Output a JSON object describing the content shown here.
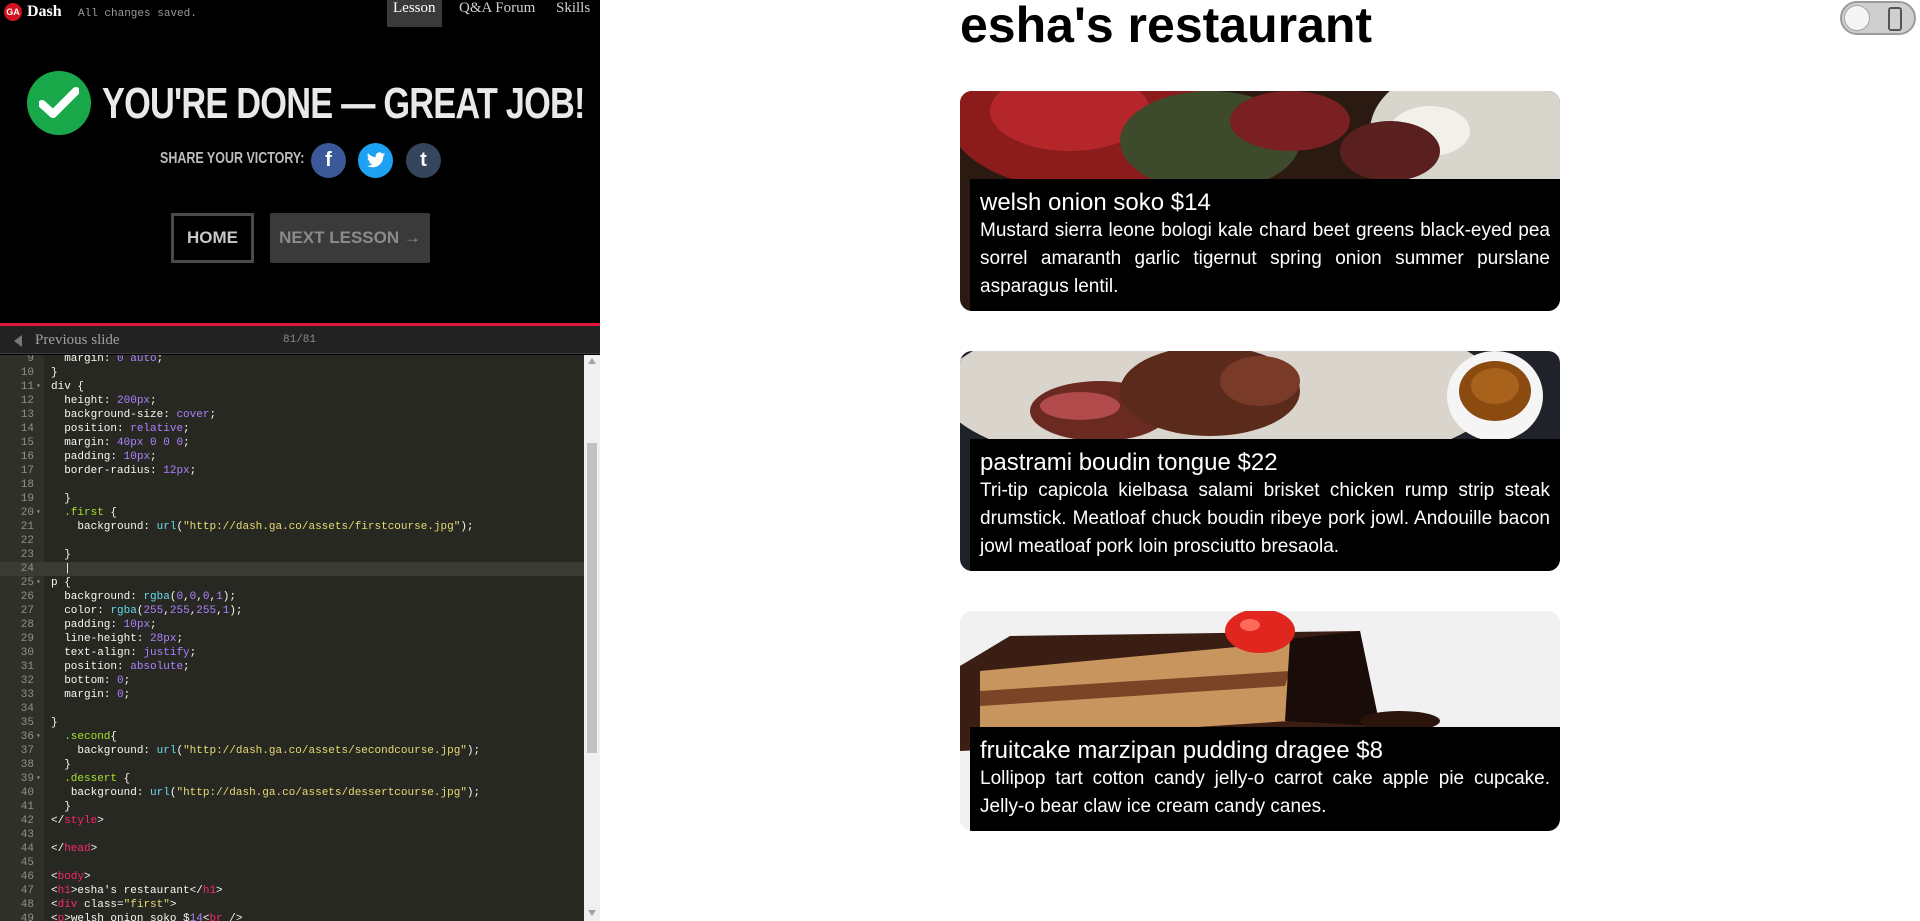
{
  "topbar": {
    "logo": "GA",
    "app_name": "Dash",
    "save_status": "All changes saved.",
    "nav": [
      {
        "label": "Lesson"
      },
      {
        "label": "Q&A Forum"
      },
      {
        "label": "Skills"
      }
    ]
  },
  "done_panel": {
    "title": "YOU'RE DONE — GREAT JOB!",
    "share_label": "SHARE YOUR VICTORY:",
    "social": {
      "facebook": "f",
      "twitter": "t",
      "tumblr": "t"
    },
    "home_label": "HOME",
    "next_label": "NEXT LESSON →"
  },
  "slidebar": {
    "prev_label": "Previous slide",
    "count": "81/81"
  },
  "editor": {
    "active_line": 24,
    "lines": [
      {
        "n": "9",
        "code": "  margin: 0 auto;"
      },
      {
        "n": "10",
        "code": "}"
      },
      {
        "n": "11",
        "code": "div {"
      },
      {
        "n": "12",
        "code": "  height: 200px;"
      },
      {
        "n": "13",
        "code": "  background-size: cover;"
      },
      {
        "n": "14",
        "code": "  position: relative;"
      },
      {
        "n": "15",
        "code": "  margin: 40px 0 0 0;"
      },
      {
        "n": "16",
        "code": "  padding: 10px;"
      },
      {
        "n": "17",
        "code": "  border-radius: 12px;"
      },
      {
        "n": "18",
        "code": ""
      },
      {
        "n": "19",
        "code": "  }"
      },
      {
        "n": "20",
        "code": "  .first {"
      },
      {
        "n": "21",
        "code": "    background: url(\"http://dash.ga.co/assets/firstcourse.jpg\");"
      },
      {
        "n": "22",
        "code": ""
      },
      {
        "n": "23",
        "code": "  }"
      },
      {
        "n": "24",
        "code": "  |"
      },
      {
        "n": "25",
        "code": "p {"
      },
      {
        "n": "26",
        "code": "  background: rgba(0,0,0,1);"
      },
      {
        "n": "27",
        "code": "  color: rgba(255,255,255,1);"
      },
      {
        "n": "28",
        "code": "  padding: 10px;"
      },
      {
        "n": "29",
        "code": "  line-height: 28px;"
      },
      {
        "n": "30",
        "code": "  text-align: justify;"
      },
      {
        "n": "31",
        "code": "  position: absolute;"
      },
      {
        "n": "32",
        "code": "  bottom: 0;"
      },
      {
        "n": "33",
        "code": "  margin: 0;"
      },
      {
        "n": "34",
        "code": ""
      },
      {
        "n": "35",
        "code": "}"
      },
      {
        "n": "36",
        "code": "  .second{"
      },
      {
        "n": "37",
        "code": "    background: url(\"http://dash.ga.co/assets/secondcourse.jpg\");"
      },
      {
        "n": "38",
        "code": "  }"
      },
      {
        "n": "39",
        "code": "  .dessert {"
      },
      {
        "n": "40",
        "code": "   background: url(\"http://dash.ga.co/assets/dessertcourse.jpg\");"
      },
      {
        "n": "41",
        "code": "  }"
      },
      {
        "n": "42",
        "code": "</style>"
      },
      {
        "n": "43",
        "code": ""
      },
      {
        "n": "44",
        "code": "</head>"
      },
      {
        "n": "45",
        "code": ""
      },
      {
        "n": "46",
        "code": "<body>"
      },
      {
        "n": "47",
        "code": "<h1>esha's restaurant</h1>"
      },
      {
        "n": "48",
        "code": "<div class=\"first\">"
      },
      {
        "n": "49",
        "code": "<p>welsh onion soko $14<br />"
      }
    ]
  },
  "preview": {
    "title": "esha's restaurant",
    "courses": [
      {
        "name": "welsh onion soko $14",
        "description": "Mustard sierra leone bologi kale chard beet greens black-eyed pea sorrel amaranth garlic tigernut spring onion summer purslane asparagus lentil."
      },
      {
        "name": "pastrami boudin tongue $22",
        "description": "Tri-tip capicola kielbasa salami brisket chicken rump strip steak drumstick. Meatloaf chuck boudin ribeye pork jowl. Andouille bacon jowl meatloaf pork loin prosciutto bresaola."
      },
      {
        "name": "fruitcake marzipan pudding dragee $8",
        "description": "Lollipop tart cotton candy jelly-o carrot cake apple pie cupcake. Jelly-o bear claw ice cream candy canes."
      }
    ]
  },
  "colors": {
    "accent_red": "#e0173b",
    "check_green": "#18a84a",
    "facebook": "#3b5998",
    "twitter": "#1da1f2",
    "tumblr": "#35465c"
  }
}
